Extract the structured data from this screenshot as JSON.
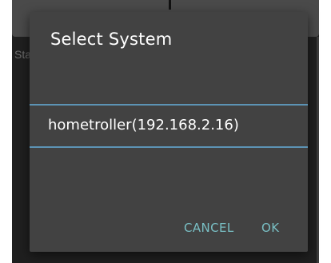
{
  "background": {
    "partial_text": "Sta"
  },
  "dialog": {
    "title": "Select System",
    "items": [
      {
        "label": "hometroller(192.168.2.16)"
      }
    ],
    "buttons": {
      "cancel": "CANCEL",
      "ok": "OK"
    }
  },
  "colors": {
    "dialog_bg": "#424242",
    "accent": "#79bfc4",
    "divider": "#5c93b5",
    "title_text": "#ffffff"
  }
}
